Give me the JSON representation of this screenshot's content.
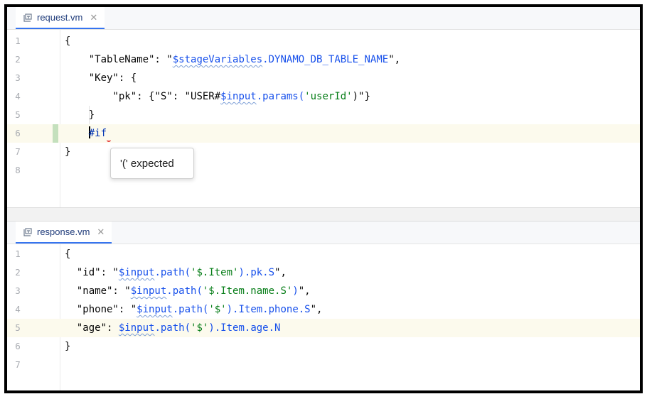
{
  "top_pane": {
    "tab": {
      "label": "request.vm",
      "close_icon": "close-icon",
      "file_icon": "velocity-file-icon"
    },
    "line_numbers": [
      "1",
      "2",
      "3",
      "4",
      "5",
      "6",
      "7",
      "8"
    ],
    "lines": [
      [
        {
          "t": "{",
          "c": ""
        }
      ],
      [
        {
          "t": "    ",
          "c": ""
        },
        {
          "t": "\"TableName\": \"",
          "c": ""
        },
        {
          "t": "$stageVariables",
          "c": "v",
          "w": true
        },
        {
          "t": ".DYNAMO_DB_TABLE_NAME",
          "c": "v"
        },
        {
          "t": "\",",
          "c": ""
        }
      ],
      [
        {
          "t": "    ",
          "c": ""
        },
        {
          "t": "\"Key\": {",
          "c": ""
        }
      ],
      [
        {
          "t": "        ",
          "c": ""
        },
        {
          "t": "\"pk\": {\"S\": \"USER#",
          "c": ""
        },
        {
          "t": "$input",
          "c": "v",
          "w": true
        },
        {
          "t": ".params(",
          "c": "v"
        },
        {
          "t": "'userId'",
          "c": "s"
        },
        {
          "t": ")\"}",
          "c": ""
        }
      ],
      [
        {
          "t": "    ",
          "c": ""
        },
        {
          "t": "}",
          "c": ""
        }
      ],
      [
        {
          "t": "    ",
          "c": ""
        },
        {
          "t": "#if",
          "c": "kw",
          "cursor": true,
          "err": true
        }
      ],
      [
        {
          "t": "}",
          "c": ""
        }
      ],
      []
    ],
    "tooltip": "'(' expected"
  },
  "bottom_pane": {
    "tab": {
      "label": "response.vm",
      "close_icon": "close-icon",
      "file_icon": "velocity-file-icon"
    },
    "line_numbers": [
      "1",
      "2",
      "3",
      "4",
      "5",
      "6",
      "7"
    ],
    "lines": [
      [
        {
          "t": "{",
          "c": ""
        }
      ],
      [
        {
          "t": "  ",
          "c": ""
        },
        {
          "t": "\"id\": \"",
          "c": ""
        },
        {
          "t": "$input",
          "c": "v",
          "w": true
        },
        {
          "t": ".path(",
          "c": "v"
        },
        {
          "t": "'$.Item'",
          "c": "s"
        },
        {
          "t": ").pk.S",
          "c": "v"
        },
        {
          "t": "\",",
          "c": ""
        }
      ],
      [
        {
          "t": "  ",
          "c": ""
        },
        {
          "t": "\"name\": \"",
          "c": ""
        },
        {
          "t": "$input",
          "c": "v",
          "w": true
        },
        {
          "t": ".path(",
          "c": "v"
        },
        {
          "t": "'$.Item.name.S'",
          "c": "s"
        },
        {
          "t": ")",
          "c": "v"
        },
        {
          "t": "\",",
          "c": ""
        }
      ],
      [
        {
          "t": "  ",
          "c": ""
        },
        {
          "t": "\"phone\": \"",
          "c": ""
        },
        {
          "t": "$input",
          "c": "v",
          "w": true
        },
        {
          "t": ".path(",
          "c": "v"
        },
        {
          "t": "'$'",
          "c": "s"
        },
        {
          "t": ").Item.phone.S",
          "c": "v"
        },
        {
          "t": "\",",
          "c": ""
        }
      ],
      [
        {
          "t": "  ",
          "c": ""
        },
        {
          "t": "\"age\": ",
          "c": ""
        },
        {
          "t": "$input",
          "c": "v",
          "w": true
        },
        {
          "t": ".path(",
          "c": "v"
        },
        {
          "t": "'$'",
          "c": "s"
        },
        {
          "t": ").Item.age.N",
          "c": "v"
        }
      ],
      [
        {
          "t": "}",
          "c": ""
        }
      ],
      []
    ]
  },
  "colors": {
    "string": "#067d17",
    "variable": "#1750eb",
    "keyword": "#0033b3",
    "line_highlight": "#fcfaed",
    "change_marker": "#c4e0bd",
    "tab_underline": "#3574f0"
  }
}
